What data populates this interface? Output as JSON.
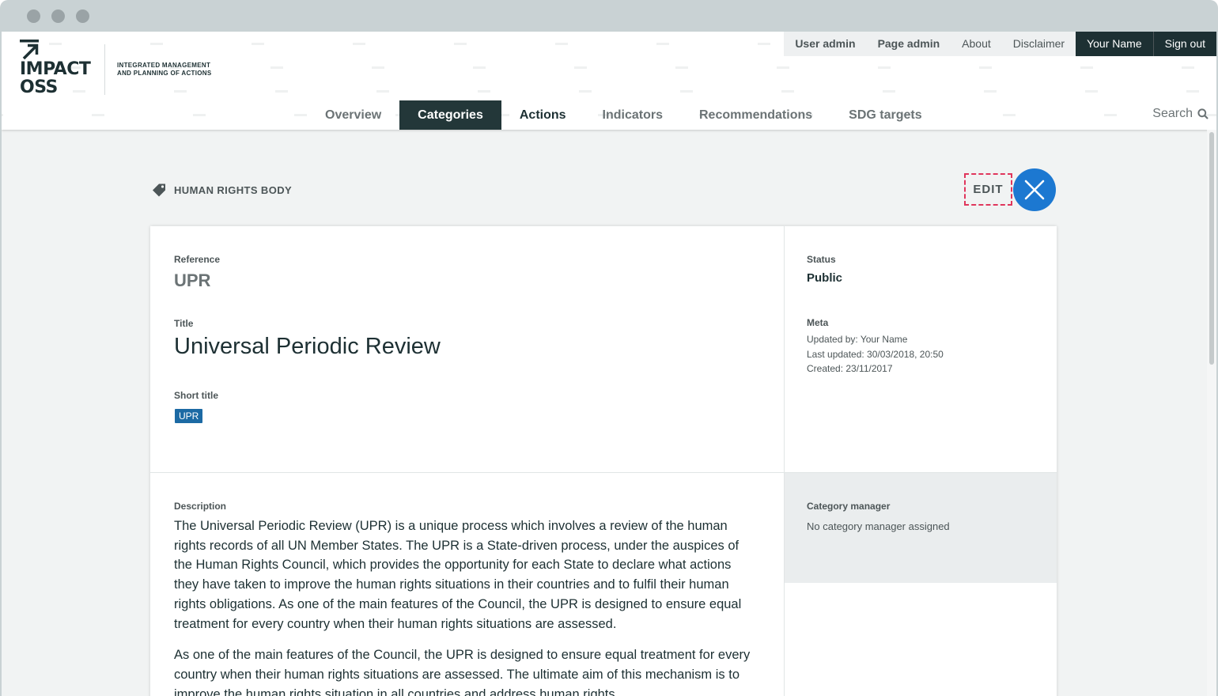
{
  "colors": {
    "accent_blue": "#1c78d1",
    "dark_nav": "#233739",
    "edit_outline": "#e0365c",
    "badge_blue": "#1c6aa4"
  },
  "logo": {
    "name_line1": "IMPACT",
    "name_line2": "OSS",
    "tagline_line1": "INTEGRATED MANAGEMENT",
    "tagline_line2": "AND PLANNING OF ACTIONS"
  },
  "topnav": {
    "user_admin": "User admin",
    "page_admin": "Page admin",
    "about": "About",
    "disclaimer": "Disclaimer",
    "user_name": "Your Name",
    "sign_out": "Sign out"
  },
  "mainnav": {
    "items": [
      "Overview",
      "Categories",
      "Actions",
      "Indicators",
      "Recommendations",
      "SDG targets"
    ],
    "active": "Categories"
  },
  "search": {
    "label": "Search",
    "icon": "search-icon"
  },
  "page": {
    "breadcrumb": "HUMAN RIGHTS BODY",
    "breadcrumb_icon": "tag-icon",
    "edit_label": "EDIT",
    "close_icon": "close-icon"
  },
  "entity": {
    "reference_label": "Reference",
    "reference_value": "UPR",
    "title_label": "Title",
    "title_value": "Universal Periodic Review",
    "short_title_label": "Short title",
    "short_title_value": "UPR",
    "status_label": "Status",
    "status_value": "Public",
    "meta_label": "Meta",
    "meta_updated_by": "Updated by: Your Name",
    "meta_last_updated": "Last updated: 30/03/2018, 20:50",
    "meta_created": "Created: 23/11/2017",
    "description_label": "Description",
    "description_p1": "The Universal Periodic Review (UPR) is a unique process which involves a review of the human rights records of all UN Member States. The UPR is a State-driven process, under the auspices of the Human Rights Council, which provides the opportunity for each State to declare what actions they have taken to improve the human rights situations in their countries and to fulfil their human rights obligations. As one of the main features of the Council, the UPR is designed to ensure equal treatment for every country when their human rights situations are assessed.",
    "description_p2": "As one of the main features of the Council, the UPR is designed to ensure equal treatment for every country when their human rights situations are assessed. The ultimate aim of this mechanism is to improve the human rights situation in all countries and address human rights",
    "manager_label": "Category manager",
    "manager_value": "No category manager assigned"
  }
}
